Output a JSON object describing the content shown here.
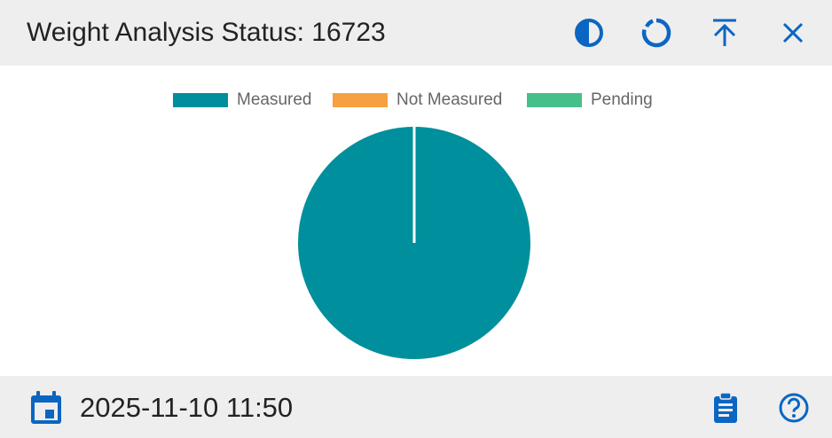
{
  "header": {
    "title": "Weight Analysis Status: 16723",
    "icons": [
      "contrast-icon",
      "refresh-icon",
      "upload-icon",
      "close-icon"
    ]
  },
  "colors": {
    "accent": "#0a66c2",
    "measured": "#008f9c",
    "not_measured": "#f5a142",
    "pending": "#45c08a",
    "bar_background": "#eeeeee"
  },
  "chart_data": {
    "type": "pie",
    "title": "",
    "labels": [
      "Measured",
      "Not Measured",
      "Pending"
    ],
    "values": [
      100,
      0,
      0
    ],
    "colors": [
      "#008f9c",
      "#f5a142",
      "#45c08a"
    ],
    "legend": "top"
  },
  "footer": {
    "datetime": "2025-11-10 11:50",
    "icons": [
      "calendar-icon",
      "clipboard-icon",
      "help-icon"
    ]
  }
}
